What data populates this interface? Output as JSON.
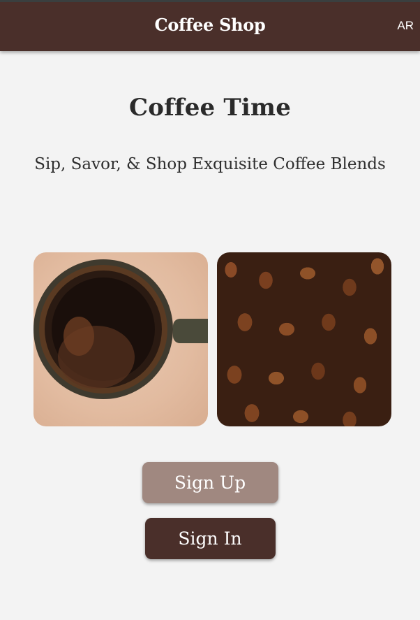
{
  "app_bar": {
    "title": "Coffee Shop",
    "language_toggle": "AR",
    "background_color": "#4a2f2a"
  },
  "hero": {
    "title": "Coffee Time",
    "subtitle": "Sip, Savor, & Shop Exquisite Coffee Blends"
  },
  "images": [
    {
      "name": "coffee-cup-photo"
    },
    {
      "name": "coffee-beans-photo"
    }
  ],
  "actions": {
    "sign_up_label": "Sign Up",
    "sign_in_label": "Sign In",
    "sign_up_color": "#a08880",
    "sign_in_color": "#4a2f2a"
  }
}
